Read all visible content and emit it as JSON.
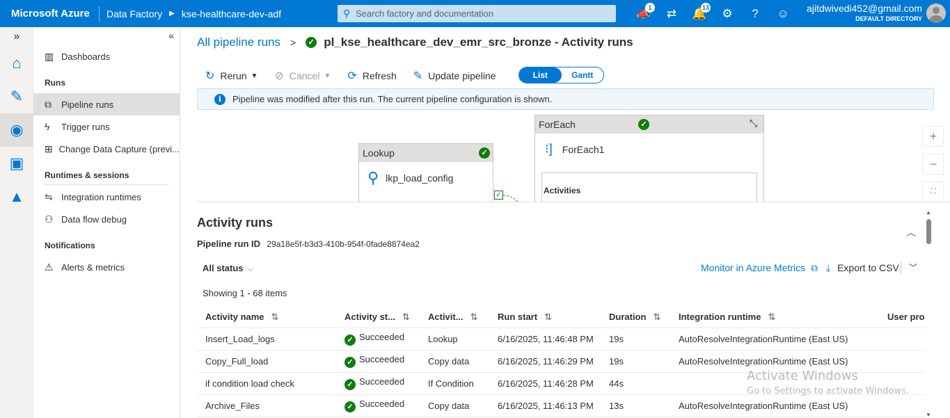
{
  "topbar": {
    "brand": "Microsoft Azure",
    "crumb1": "Data Factory",
    "crumb2": "kse-healthcare-dev-adf",
    "search_placeholder": "Search factory and documentation",
    "badge_whatsnew": "1",
    "badge_notifications": "13",
    "user_email": "ajitdwivedi452@gmail.com",
    "user_directory": "DEFAULT DIRECTORY"
  },
  "nav": {
    "dashboards": "Dashboards",
    "runs_header": "Runs",
    "pipeline_runs": "Pipeline runs",
    "trigger_runs": "Trigger runs",
    "cdc": "Change Data Capture (previ...",
    "runtimes_header": "Runtimes & sessions",
    "integration_runtimes": "Integration runtimes",
    "data_flow_debug": "Data flow debug",
    "notifications_header": "Notifications",
    "alerts": "Alerts & metrics"
  },
  "header": {
    "back_link": "All pipeline runs",
    "separator": ">",
    "pipeline_title": "pl_kse_healthcare_dev_emr_src_bronze - Activity runs"
  },
  "toolbar": {
    "rerun": "Rerun",
    "cancel": "Cancel",
    "refresh": "Refresh",
    "update_pipeline": "Update pipeline",
    "view_list": "List",
    "view_gantt": "Gantt"
  },
  "info_banner": "Pipeline was modified after this run. The current pipeline configuration is shown.",
  "canvas": {
    "lookup_header": "Lookup",
    "lookup_name": "lkp_load_config",
    "foreach_header": "ForEach",
    "foreach_name": "ForEach1",
    "activities_label": "Activities"
  },
  "activity_runs": {
    "title": "Activity runs",
    "run_id_label": "Pipeline run ID",
    "run_id": "29a18e5f-b3d3-410b-954f-0fade8874ea2",
    "status_filter": "All status",
    "monitor_link": "Monitor in Azure Metrics",
    "export": "Export to CSV",
    "showing": "Showing 1 - 68 items",
    "columns": [
      "Activity name",
      "Activity st...",
      "Activit...",
      "Run start",
      "Duration",
      "Integration runtime",
      "User prop"
    ],
    "rows": [
      {
        "name": "Insert_Load_logs",
        "status": "Succeeded",
        "type": "Lookup",
        "start": "6/16/2025, 11:46:48 PM",
        "duration": "19s",
        "runtime": "AutoResolveIntegrationRuntime (East US)"
      },
      {
        "name": "Copy_Full_load",
        "status": "Succeeded",
        "type": "Copy data",
        "start": "6/16/2025, 11:46:29 PM",
        "duration": "19s",
        "runtime": "AutoResolveIntegrationRuntime (East US)"
      },
      {
        "name": "if condition load check",
        "status": "Succeeded",
        "type": "If Condition",
        "start": "6/16/2025, 11:46:28 PM",
        "duration": "44s",
        "runtime": ""
      },
      {
        "name": "Archive_Files",
        "status": "Succeeded",
        "type": "Copy data",
        "start": "6/16/2025, 11:46:13 PM",
        "duration": "13s",
        "runtime": "AutoResolveIntegrationRuntime (East US)"
      }
    ]
  },
  "watermark": {
    "line1": "Activate Windows",
    "line2": "Go to Settings to activate Windows."
  },
  "colors": {
    "accent": "#0078d4",
    "success": "#107c10"
  }
}
